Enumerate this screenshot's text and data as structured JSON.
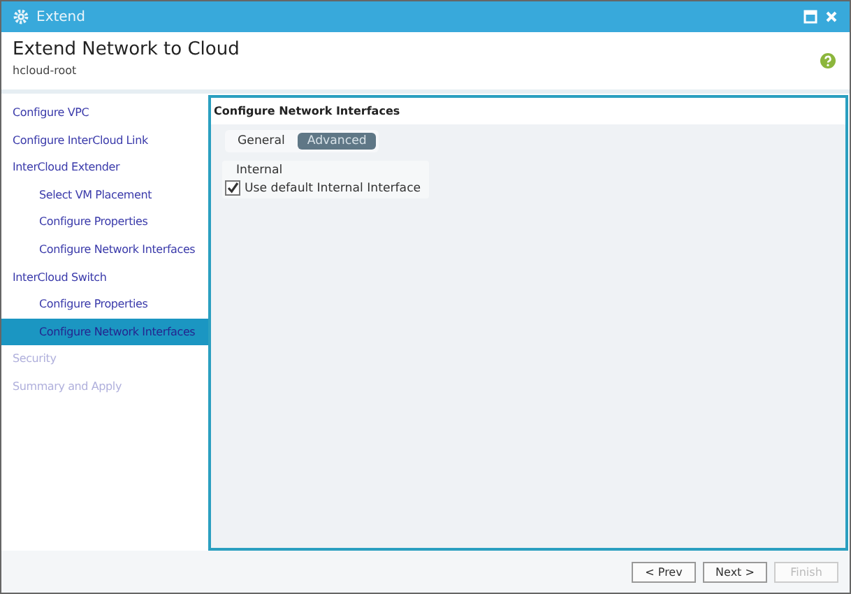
{
  "window": {
    "title": "Extend"
  },
  "header": {
    "title": "Extend Network to Cloud",
    "subtitle": "hcloud-root"
  },
  "sidebar": {
    "items": [
      {
        "label": "Configure VPC",
        "selected": false,
        "disabled": false
      },
      {
        "label": "Configure InterCloud Link",
        "selected": false,
        "disabled": false
      },
      {
        "label": "InterCloud Extender",
        "selected": false,
        "disabled": false,
        "children": [
          {
            "label": "Select VM Placement",
            "selected": false,
            "disabled": false
          },
          {
            "label": "Configure Properties",
            "selected": false,
            "disabled": false
          },
          {
            "label": "Configure Network Interfaces",
            "selected": false,
            "disabled": false
          }
        ]
      },
      {
        "label": "InterCloud Switch",
        "selected": false,
        "disabled": false,
        "children": [
          {
            "label": "Configure Properties",
            "selected": false,
            "disabled": false
          },
          {
            "label": "Configure Network Interfaces",
            "selected": true,
            "disabled": false
          }
        ]
      },
      {
        "label": "Security",
        "selected": false,
        "disabled": true
      },
      {
        "label": "Summary and Apply",
        "selected": false,
        "disabled": true
      }
    ]
  },
  "panel": {
    "title": "Configure Network Interfaces",
    "tabs": [
      {
        "label": "General",
        "selected": false
      },
      {
        "label": "Advanced",
        "selected": true
      }
    ],
    "group": {
      "legend": "Internal",
      "checkbox": {
        "label": "Use default Internal Interface",
        "checked": true
      }
    }
  },
  "buttons": [
    {
      "label": "< Prev",
      "disabled": false
    },
    {
      "label": "Next >",
      "disabled": false
    },
    {
      "label": "Finish",
      "disabled": true
    }
  ]
}
